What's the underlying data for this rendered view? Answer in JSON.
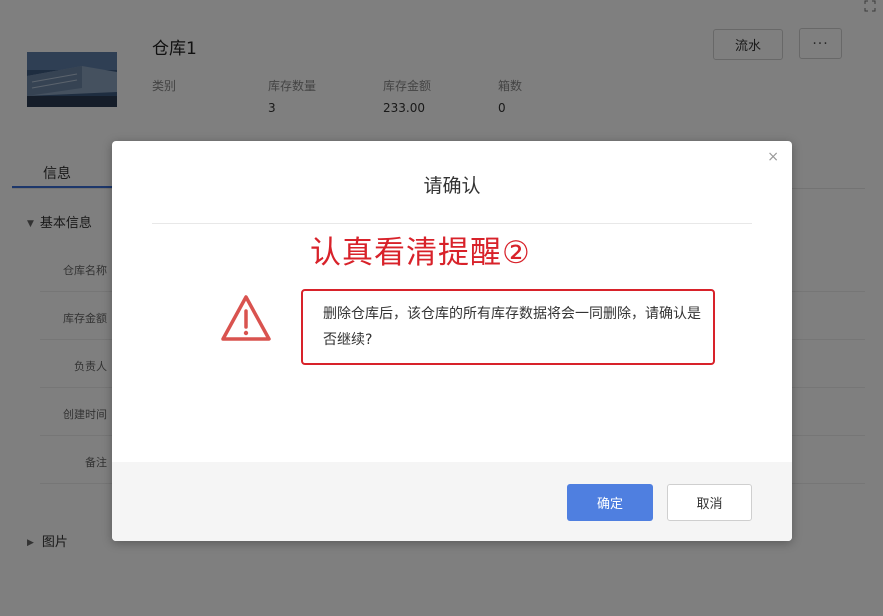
{
  "header": {
    "title": "仓库1",
    "flow_button": "流水",
    "more_button": "···"
  },
  "stats": [
    {
      "label": "类别",
      "value": ""
    },
    {
      "label": "库存数量",
      "value": "3"
    },
    {
      "label": "库存金额",
      "value": "233.00"
    },
    {
      "label": "箱数",
      "value": "0"
    }
  ],
  "tabs": {
    "info": "信息"
  },
  "basic_section": {
    "title": "基本信息",
    "fields": [
      "仓库名称",
      "库存金额",
      "负责人",
      "创建时间",
      "备注"
    ]
  },
  "picture_section": {
    "title": "图片"
  },
  "dialog": {
    "close": "×",
    "title": "请确认",
    "annotation": "认真看清提醒②",
    "message": "删除仓库后，该仓库的所有库存数据将会一同删除，请确认是否继续?",
    "confirm_button": "确定",
    "cancel_button": "取消"
  },
  "colors": {
    "primary": "#4f7fe0",
    "annotation_red": "#d8222a",
    "warning_icon": "#d9534f"
  }
}
